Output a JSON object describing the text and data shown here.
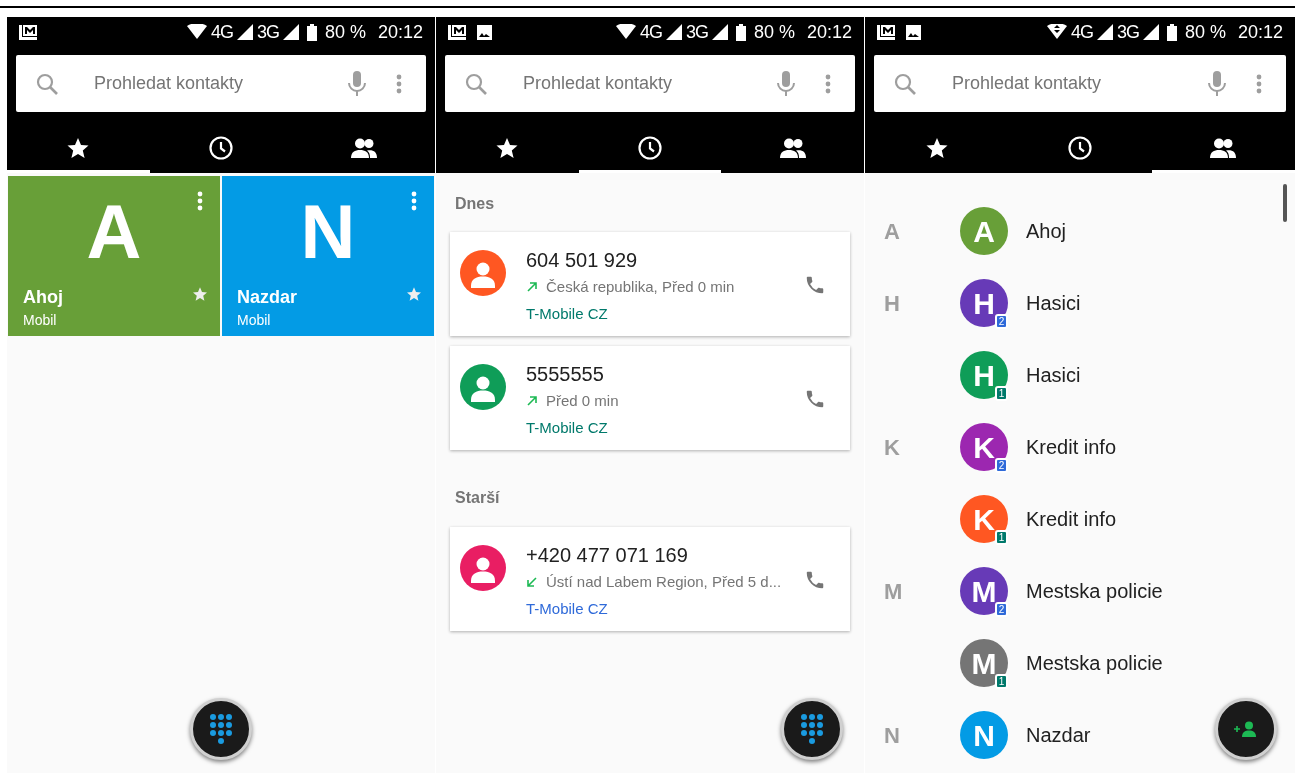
{
  "screens": [
    {
      "status_bar": {
        "notifications": [
          {
            "kind": "mail"
          }
        ],
        "network_1": "4G",
        "network_2": "3G",
        "battery": "80 %",
        "time": "20:12"
      },
      "search": {
        "placeholder": "Prohledat kontakty"
      },
      "tabs": [
        {
          "kind": "favorites",
          "selected": true
        },
        {
          "kind": "recents",
          "selected": false
        },
        {
          "kind": "contacts",
          "selected": false
        }
      ],
      "content": {
        "kind": "favorites",
        "tiles": [
          {
            "letter": "A",
            "name": "Ahoj",
            "label": "Mobil",
            "color": "#689f38"
          },
          {
            "letter": "N",
            "name": "Nazdar",
            "label": "Mobil",
            "color": "#039be5"
          }
        ]
      },
      "fab": {
        "kind": "dialpad"
      }
    },
    {
      "status_bar": {
        "notifications": [
          {
            "kind": "mail"
          },
          {
            "kind": "image"
          }
        ],
        "network_1": "4G",
        "network_2": "3G",
        "battery": "80 %",
        "time": "20:12"
      },
      "search": {
        "placeholder": "Prohledat kontakty"
      },
      "tabs": [
        {
          "kind": "favorites",
          "selected": false
        },
        {
          "kind": "recents",
          "selected": true
        },
        {
          "kind": "contacts",
          "selected": false
        }
      ],
      "content": {
        "kind": "recents",
        "sections": [
          {
            "heading": "Dnes",
            "calls": [
              {
                "number": "604 501 929",
                "incoming": false,
                "detail": "Česká republika, Před 0 min",
                "carrier": {
                  "name": "T-Mobile CZ",
                  "color": "#00796b"
                },
                "avatar": {
                  "color": "#ff5722"
                }
              },
              {
                "number": "5555555",
                "incoming": false,
                "detail": "Před 0 min",
                "carrier": {
                  "name": "T-Mobile CZ",
                  "color": "#00796b"
                },
                "avatar": {
                  "color": "#0f9d58"
                }
              }
            ]
          },
          {
            "heading": "Starší",
            "calls": [
              {
                "number": "+420 477 071 169",
                "incoming": true,
                "detail": "Ústí nad Labem Region, Před 5 d...",
                "carrier": {
                  "name": "T-Mobile CZ",
                  "color": "#2f6ad9"
                },
                "avatar": {
                  "color": "#e91e63"
                }
              }
            ]
          }
        ]
      },
      "fab": {
        "kind": "dialpad"
      }
    },
    {
      "status_bar": {
        "notifications": [
          {
            "kind": "mail"
          },
          {
            "kind": "image"
          }
        ],
        "network_1": "4G",
        "network_2": "3G",
        "battery": "80 %",
        "time": "20:12"
      },
      "search": {
        "placeholder": "Prohledat kontakty"
      },
      "tabs": [
        {
          "kind": "favorites",
          "selected": false
        },
        {
          "kind": "recents",
          "selected": false
        },
        {
          "kind": "contacts",
          "selected": true
        }
      ],
      "content": {
        "kind": "contacts",
        "groups": [
          {
            "letter": "A",
            "contacts": [
              {
                "initial": "A",
                "name": "Ahoj",
                "color": "#689f38"
              }
            ]
          },
          {
            "letter": "H",
            "contacts": [
              {
                "initial": "H",
                "name": "Hasici",
                "color": "#673ab7",
                "sim": "2"
              },
              {
                "initial": "H",
                "name": "Hasici",
                "color": "#0f9d58",
                "sim": "1"
              }
            ]
          },
          {
            "letter": "K",
            "contacts": [
              {
                "initial": "K",
                "name": "Kredit info",
                "color": "#9c27b0",
                "sim": "2"
              },
              {
                "initial": "K",
                "name": "Kredit info",
                "color": "#ff5722",
                "sim": "1"
              }
            ]
          },
          {
            "letter": "M",
            "contacts": [
              {
                "initial": "M",
                "name": "Mestska policie",
                "color": "#673ab7",
                "sim": "2"
              },
              {
                "initial": "M",
                "name": "Mestska policie",
                "color": "#757575",
                "sim": "1"
              }
            ]
          },
          {
            "letter": "N",
            "contacts": [
              {
                "initial": "N",
                "name": "Nazdar",
                "color": "#039be5"
              }
            ]
          }
        ]
      },
      "fab": {
        "kind": "add_contact"
      }
    }
  ]
}
